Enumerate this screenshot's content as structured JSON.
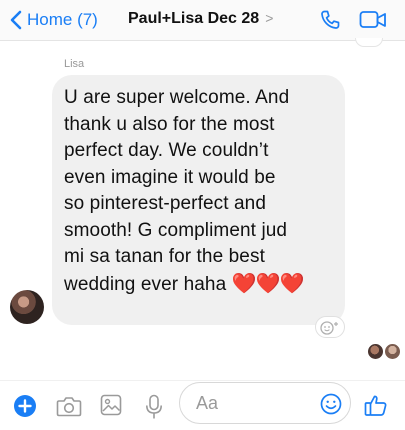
{
  "header": {
    "back_label": "Home (7)",
    "title": "Paul+Lisa Dec 28",
    "title_chevron": ">",
    "call_icon": "phone-icon",
    "video_icon": "video-camera-icon",
    "accent_color": "#1a7ef5"
  },
  "message": {
    "sender": "Lisa",
    "lines": [
      "U are super welcome. And",
      "thank u also for the most",
      "perfect day. We couldn’t",
      "even imagine it would be",
      "so pinterest-perfect and",
      "smooth! G compliment jud",
      "mi sa tanan for the best",
      "wedding ever haha"
    ],
    "hearts": "❤️❤️❤️",
    "reaction_icon": "add-reaction-icon"
  },
  "composer": {
    "placeholder": "Aa",
    "icons": [
      "plus-icon",
      "camera-icon",
      "gallery-icon",
      "microphone-icon",
      "emoji-icon",
      "thumbs-up-icon"
    ]
  }
}
